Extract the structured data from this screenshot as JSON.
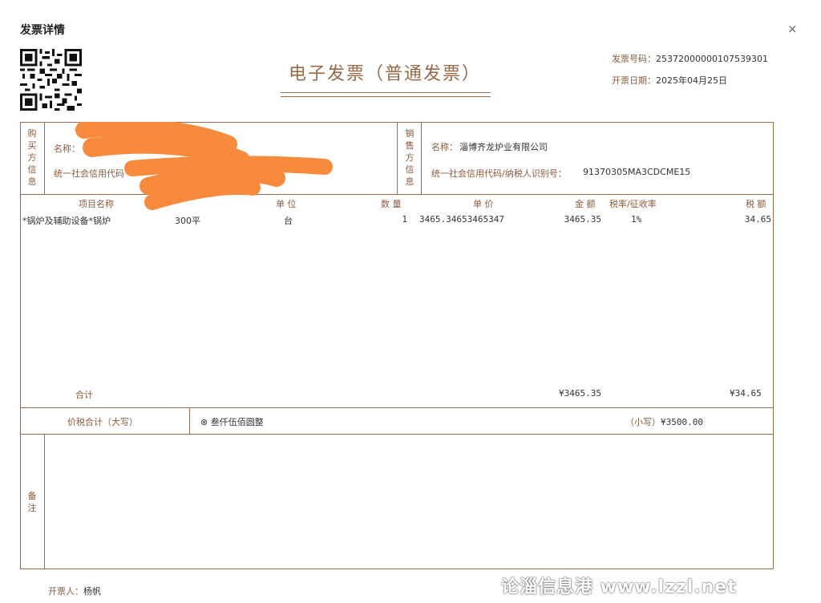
{
  "dialog": {
    "title": "发票详情",
    "close_symbol": "×"
  },
  "invoice": {
    "title": "电子发票（普通发票）",
    "number_label": "发票号码：",
    "number": "25372000000107539301",
    "date_label": "开票日期：",
    "date": "2025年04月25日"
  },
  "buyer": {
    "vertical_label": [
      "购",
      "买",
      "方",
      "信",
      "息"
    ],
    "name_label": "名称：",
    "name": "",
    "credit_label": "统一社会信用代码",
    "credit": ""
  },
  "seller": {
    "vertical_label": [
      "销",
      "售",
      "方",
      "信",
      "息"
    ],
    "name_label": "名称：",
    "name": "淄博齐龙炉业有限公司",
    "credit_label": "统一社会信用代码/纳税人识别号：",
    "credit": "91370305MA3CDCME15"
  },
  "items_header": {
    "name": "项目名称",
    "unit": "单 位",
    "quantity": "数 量",
    "price": "单 价",
    "amount": "金 额",
    "tax_rate": "税率/征收率",
    "tax": "税 额"
  },
  "items": [
    {
      "name": "*锅炉及辅助设备*锅炉",
      "spec": "300平",
      "unit": "台",
      "quantity": "1",
      "price": "3465.34653465347",
      "amount": "3465.35",
      "tax_rate": "1%",
      "tax": "34.65"
    }
  ],
  "totals": {
    "label": "合计",
    "amount": "¥3465.35",
    "tax": "¥34.65"
  },
  "grand_total": {
    "label": "价税合计（大写）",
    "upper_symbol": "⊗",
    "upper": "叁仟伍佰圆整",
    "lower_label": "（小写）",
    "lower": "¥3500.00"
  },
  "remarks": {
    "vertical_label": [
      "备",
      "注"
    ]
  },
  "issuer": {
    "label": "开票人：",
    "name": "杨帆"
  },
  "watermark": "论淄信息港 www.lzzl.net",
  "colors": {
    "accent": "#9a6a48",
    "label": "#8b5a3c",
    "redaction": "#f78a3c"
  }
}
